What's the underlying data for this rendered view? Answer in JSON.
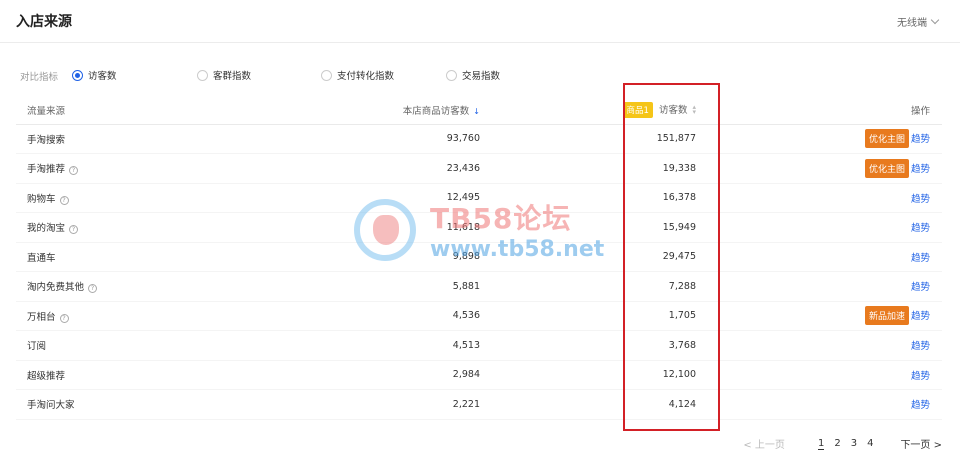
{
  "header": {
    "title": "入店来源",
    "device": "无线端"
  },
  "metrics": {
    "label": "对比指标",
    "options": [
      {
        "label": "访客数",
        "checked": true
      },
      {
        "label": "客群指数",
        "checked": false
      },
      {
        "label": "支付转化指数",
        "checked": false
      },
      {
        "label": "交易指数",
        "checked": false
      }
    ]
  },
  "table": {
    "headers": {
      "source": "流量来源",
      "store_visitors": "本店商品访客数",
      "product_tag": "商品1",
      "visitors": "访客数",
      "action": "操作"
    },
    "rows": [
      {
        "source": "手淘搜索",
        "help": false,
        "store": "93,760",
        "product": "151,877",
        "tag": "优化主图",
        "trend": "趋势"
      },
      {
        "source": "手淘推荐",
        "help": true,
        "store": "23,436",
        "product": "19,338",
        "tag": "优化主图",
        "trend": "趋势"
      },
      {
        "source": "购物车",
        "help": true,
        "store": "12,495",
        "product": "16,378",
        "tag": "",
        "trend": "趋势"
      },
      {
        "source": "我的淘宝",
        "help": true,
        "store": "11,618",
        "product": "15,949",
        "tag": "",
        "trend": "趋势"
      },
      {
        "source": "直通车",
        "help": false,
        "store": "9,898",
        "product": "29,475",
        "tag": "",
        "trend": "趋势"
      },
      {
        "source": "淘内免费其他",
        "help": true,
        "store": "5,881",
        "product": "7,288",
        "tag": "",
        "trend": "趋势"
      },
      {
        "source": "万相台",
        "help": true,
        "store": "4,536",
        "product": "1,705",
        "tag": "新品加速",
        "trend": "趋势"
      },
      {
        "source": "订阅",
        "help": false,
        "store": "4,513",
        "product": "3,768",
        "tag": "",
        "trend": "趋势"
      },
      {
        "source": "超级推荐",
        "help": false,
        "store": "2,984",
        "product": "12,100",
        "tag": "",
        "trend": "趋势"
      },
      {
        "source": "手淘问大家",
        "help": false,
        "store": "2,221",
        "product": "4,124",
        "tag": "",
        "trend": "趋势"
      }
    ]
  },
  "pagination": {
    "prev": "< 上一页",
    "pages": [
      "1",
      "2",
      "3",
      "4"
    ],
    "current": "1",
    "next": "下一页 >"
  },
  "watermark": {
    "title": "TB58论坛",
    "url": "www.tb58.net"
  },
  "colors": {
    "accent": "#2062e6",
    "tag_orange": "#e87a1e",
    "product_tag": "#f5c518",
    "highlight": "#d32026"
  }
}
